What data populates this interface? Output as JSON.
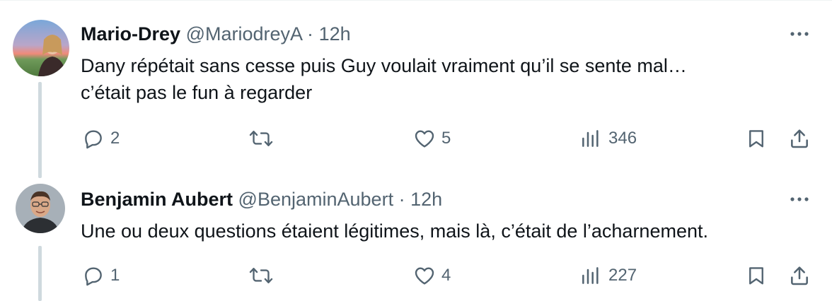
{
  "tweets": [
    {
      "name": "Mario-Drey",
      "handle": "@MariodreyA",
      "separator": "·",
      "time": "12h",
      "text_lines": [
        "Dany répétait sans cesse puis Guy voulait vraiment qu’il se sente mal…",
        "c’était pas le fun à regarder"
      ],
      "replies": "2",
      "retweets": "",
      "likes": "5",
      "views": "346"
    },
    {
      "name": "Benjamin Aubert",
      "handle": "@BenjaminAubert",
      "separator": "·",
      "time": "12h",
      "text_lines": [
        "Une ou deux questions étaient légitimes, mais là, c’était de l’acharnement."
      ],
      "replies": "1",
      "retweets": "",
      "likes": "4",
      "views": "227"
    }
  ],
  "colors": {
    "text": "#0f1419",
    "secondary": "#536471",
    "thread_line": "#cfd9de"
  },
  "icons": [
    "reply-icon",
    "retweet-icon",
    "like-icon",
    "views-icon",
    "bookmark-icon",
    "share-icon",
    "more-icon"
  ]
}
